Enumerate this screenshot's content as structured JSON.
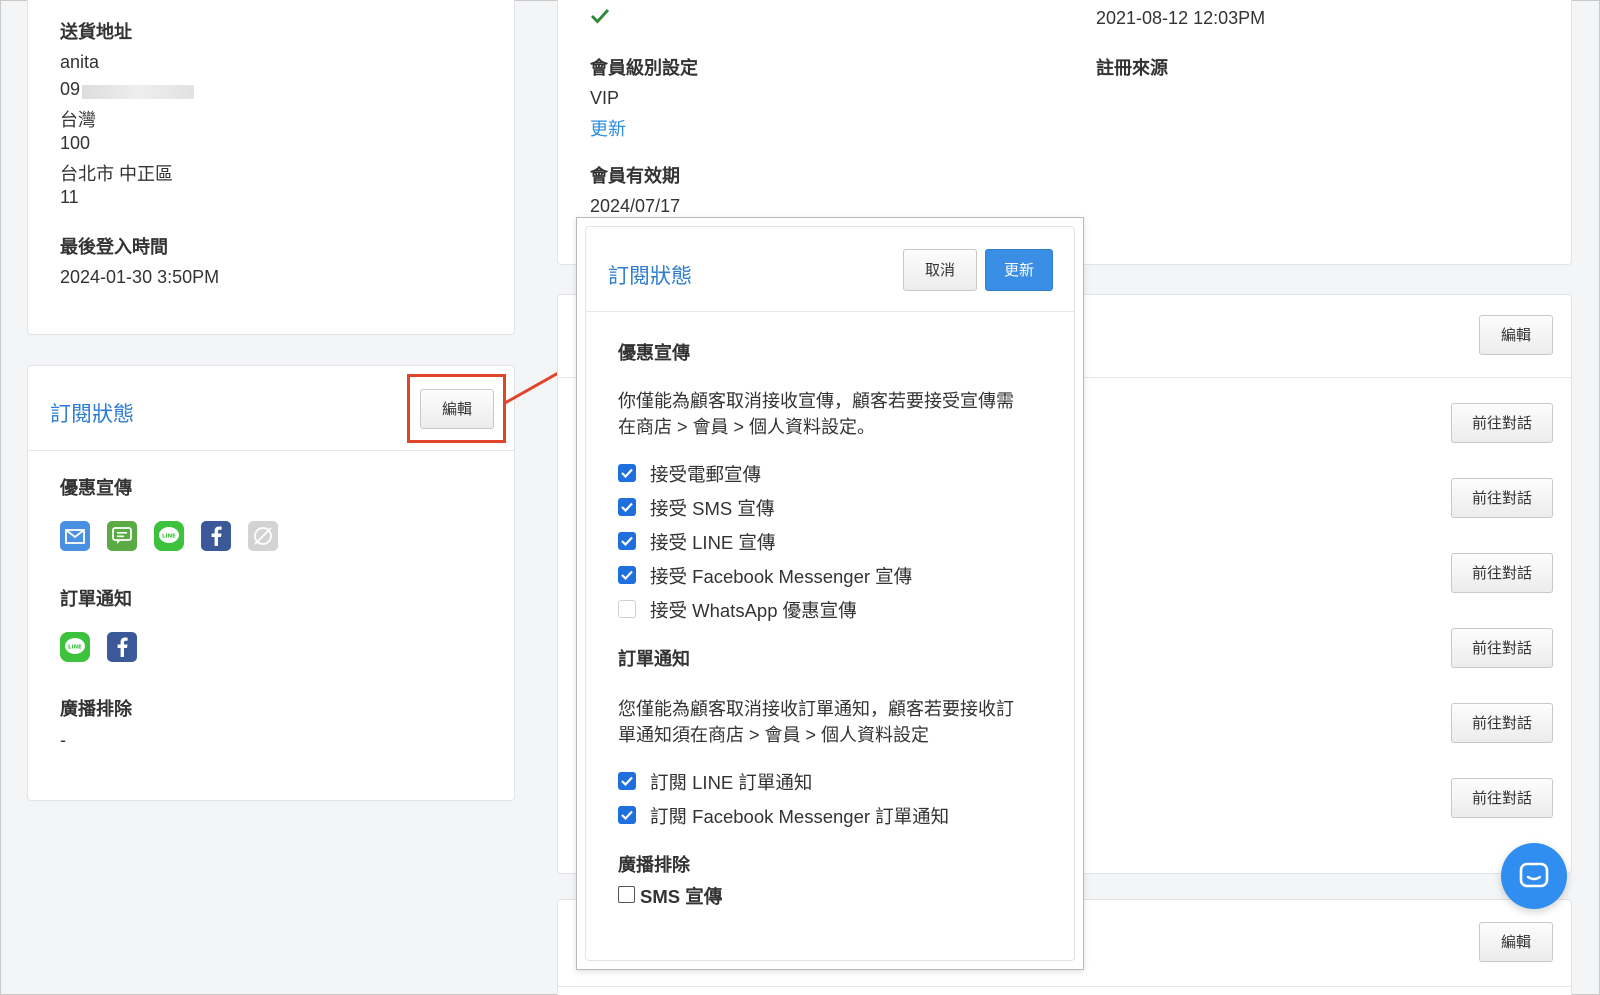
{
  "left_card_top": {
    "shipping_label": "送貨地址",
    "name": "anita",
    "phone_prefix": "09",
    "country": "台灣",
    "zip": "100",
    "city": "台北市 中正區",
    "address": "11",
    "last_login_label": "最後登入時間",
    "last_login_value": "2024-01-30 3:50PM"
  },
  "subscription_card": {
    "title": "訂閱狀態",
    "edit_label": "編輯",
    "promo_label": "優惠宣傳",
    "promo_icons": [
      "email-icon",
      "sms-icon",
      "line-icon",
      "facebook-icon",
      "whatsapp-disabled-icon"
    ],
    "order_label": "訂單通知",
    "order_icons": [
      "line-icon",
      "facebook-icon"
    ],
    "broadcast_label": "廣播排除",
    "broadcast_value": "-"
  },
  "member_card": {
    "registered_time": "2021-08-12 12:03PM",
    "tier_label": "會員級別設定",
    "tier_value": "VIP",
    "tier_update": "更新",
    "register_source_label": "註冊來源",
    "validity_label": "會員有效期",
    "validity_value": "2024/07/17"
  },
  "right_panel": {
    "edit_label": "編輯",
    "chat_buttons": [
      "前往對話",
      "前往對話",
      "前往對話",
      "前往對話",
      "前往對話",
      "前往對話"
    ],
    "bottom_edit_label": "編輯"
  },
  "modal": {
    "title": "訂閱狀態",
    "cancel_label": "取消",
    "update_label": "更新",
    "promo_heading": "優惠宣傳",
    "promo_note_line1": "你僅能為顧客取消接收宣傳，顧客若要接受宣傳需",
    "promo_note_line2": "在商店 > 會員 > 個人資料設定。",
    "promo_options": [
      {
        "label": "接受電郵宣傳",
        "checked": true
      },
      {
        "label": "接受 SMS 宣傳",
        "checked": true
      },
      {
        "label": "接受 LINE 宣傳",
        "checked": true
      },
      {
        "label": "接受 Facebook Messenger 宣傳",
        "checked": true
      },
      {
        "label": "接受 WhatsApp 優惠宣傳",
        "checked": false
      }
    ],
    "order_heading": "訂單通知",
    "order_note_line1": "您僅能為顧客取消接收訂單通知，顧客若要接收訂",
    "order_note_line2": "單通知須在商店 > 會員 > 個人資料設定",
    "order_options": [
      {
        "label": "訂閱 LINE 訂單通知",
        "checked": true
      },
      {
        "label": "訂閱 Facebook Messenger 訂單通知",
        "checked": true
      }
    ],
    "broadcast_heading": "廣播排除",
    "broadcast_option": "SMS 宣傳"
  },
  "colors": {
    "accent_blue": "#2d7dd2",
    "primary_button": "#3a8ee6",
    "checkbox_on": "#1f6fdc",
    "highlight_red": "#e0452b",
    "check_green": "#2e8b3a"
  }
}
